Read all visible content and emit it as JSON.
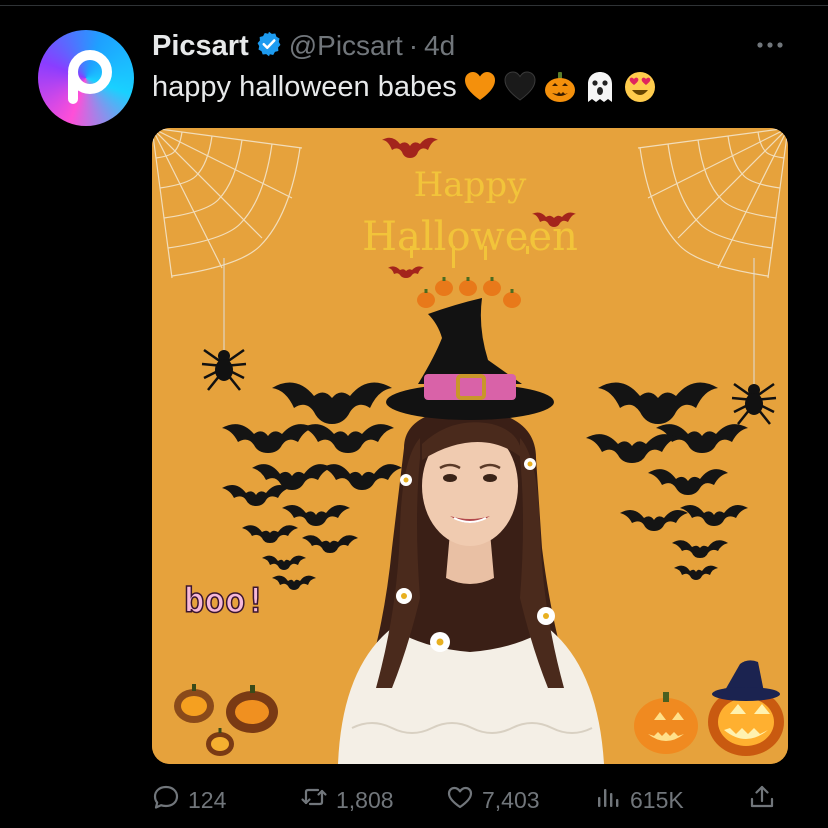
{
  "tweet": {
    "author_name": "Picsart",
    "handle": "@Picsart",
    "separator": "·",
    "time": "4d",
    "text": "happy halloween babes",
    "emojis": [
      "orange-heart",
      "black-heart",
      "jack-o-lantern",
      "ghost",
      "heart-eyes-face"
    ]
  },
  "media": {
    "title_line1": "Happy",
    "title_line2": "Halloween",
    "boo_text": "boo!",
    "background_color": "#e6a23c"
  },
  "actions": {
    "replies": "124",
    "reposts": "1,808",
    "likes": "7,403",
    "views": "615K"
  },
  "colors": {
    "verified_badge": "#1d9bf0",
    "text_primary": "#e7e9ea",
    "text_secondary": "#71767b"
  }
}
